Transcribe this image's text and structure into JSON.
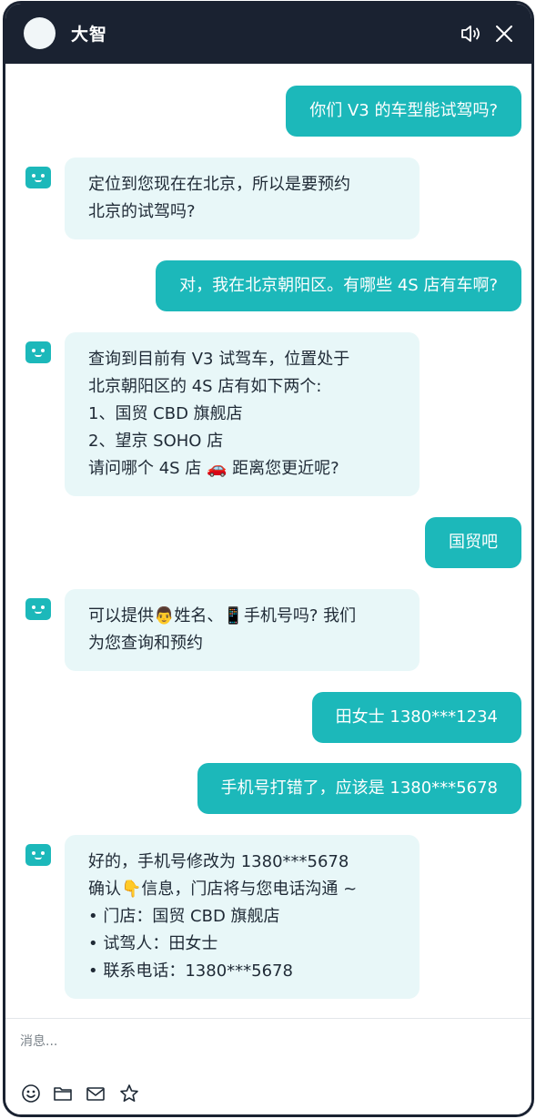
{
  "header": {
    "title": "大智"
  },
  "messages": [
    {
      "role": "user",
      "text": "你们 V3 的车型能试驾吗?"
    },
    {
      "role": "bot",
      "text": "定位到您现在在北京，所以是要预约\n北京的试驾吗?"
    },
    {
      "role": "user",
      "text": "对，我在北京朝阳区。有哪些 4S 店有车啊?"
    },
    {
      "role": "bot",
      "text": "查询到目前有 V3 试驾车，位置处于\n北京朝阳区的 4S 店有如下两个:\n1、国贸 CBD 旗舰店\n2、望京 SOHO 店\n请问哪个 4S 店 🚗 距离您更近呢?"
    },
    {
      "role": "user",
      "text": "国贸吧"
    },
    {
      "role": "bot",
      "text": "可以提供👨姓名、📱手机号吗? 我们\n为您查询和预约"
    },
    {
      "role": "user",
      "text": "田女士  1380***1234"
    },
    {
      "role": "user",
      "text": "手机号打错了，应该是 1380***5678"
    },
    {
      "role": "bot",
      "text": "好的，手机号修改为 1380***5678\n确认👇信息，门店将与您电话沟通 ~\n• 门店：国贸 CBD 旗舰店\n• 试驾人：田女士\n• 联系电话：1380***5678"
    }
  ],
  "composer": {
    "placeholder": "消息..."
  },
  "toolbar_icons": [
    "emoji-icon",
    "folder-icon",
    "mail-icon",
    "star-icon"
  ],
  "colors": {
    "header_bg": "#1a2231",
    "accent": "#1cb8ba",
    "bot_bubble": "#e8f7f8"
  }
}
